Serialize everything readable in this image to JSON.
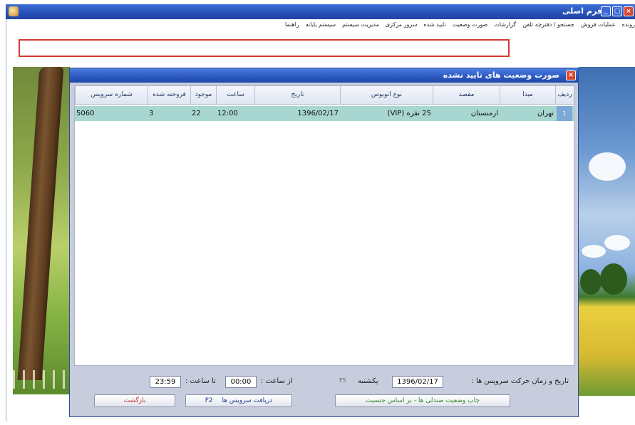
{
  "app": {
    "title": "فرم اصلی",
    "menu": [
      "رونده",
      "عملیات فروش",
      "جستجو / دفترچه تلفن",
      "گزارشات",
      "صورت وضعیت",
      "تایید شده",
      "سرور مرکزی",
      "مدیریت سیستم",
      "سیستم پایانه",
      "راهنما"
    ]
  },
  "dialog": {
    "title": "صورت وضعیت های تایید نشده",
    "columns": [
      "ردیف",
      "مبدا",
      "مقصد",
      "نوع اتوبوس",
      "تاریخ",
      "ساعت",
      "موجود",
      "فروخته شده",
      "شماره سرویس"
    ],
    "rows": [
      {
        "index": "1",
        "origin": "تهران",
        "destination": "ارمنستان",
        "bus_type": "25 نفره (VIP)",
        "date": "1396/02/17",
        "time": "12:00",
        "available": "22",
        "sold": "3",
        "service_no": "5060"
      }
    ],
    "footer": {
      "date_label": "تاریخ و زمان حرکت سرویس ها :",
      "date_value": "1396/02/17",
      "weekday": "یکشنبه",
      "f5": "F5",
      "from_label": "از ساعت :",
      "from_value": "00:00",
      "to_label": "تا ساعت :",
      "to_value": "23:59",
      "print_button": "چاپ وضعیت صندلی ها - بر اساس جنسیت",
      "fetch_button": "دریافت سرویس ها",
      "fetch_key": "F2",
      "back_button": "بازگشت"
    }
  },
  "colors": {
    "row_highlight": "#a8d6d0",
    "row_outline": "#d23a2f",
    "title_bar": "#2d5bc2",
    "print_text": "#3a8a2a",
    "fetch_text": "#1f3f8f",
    "back_text": "#c0392b"
  }
}
